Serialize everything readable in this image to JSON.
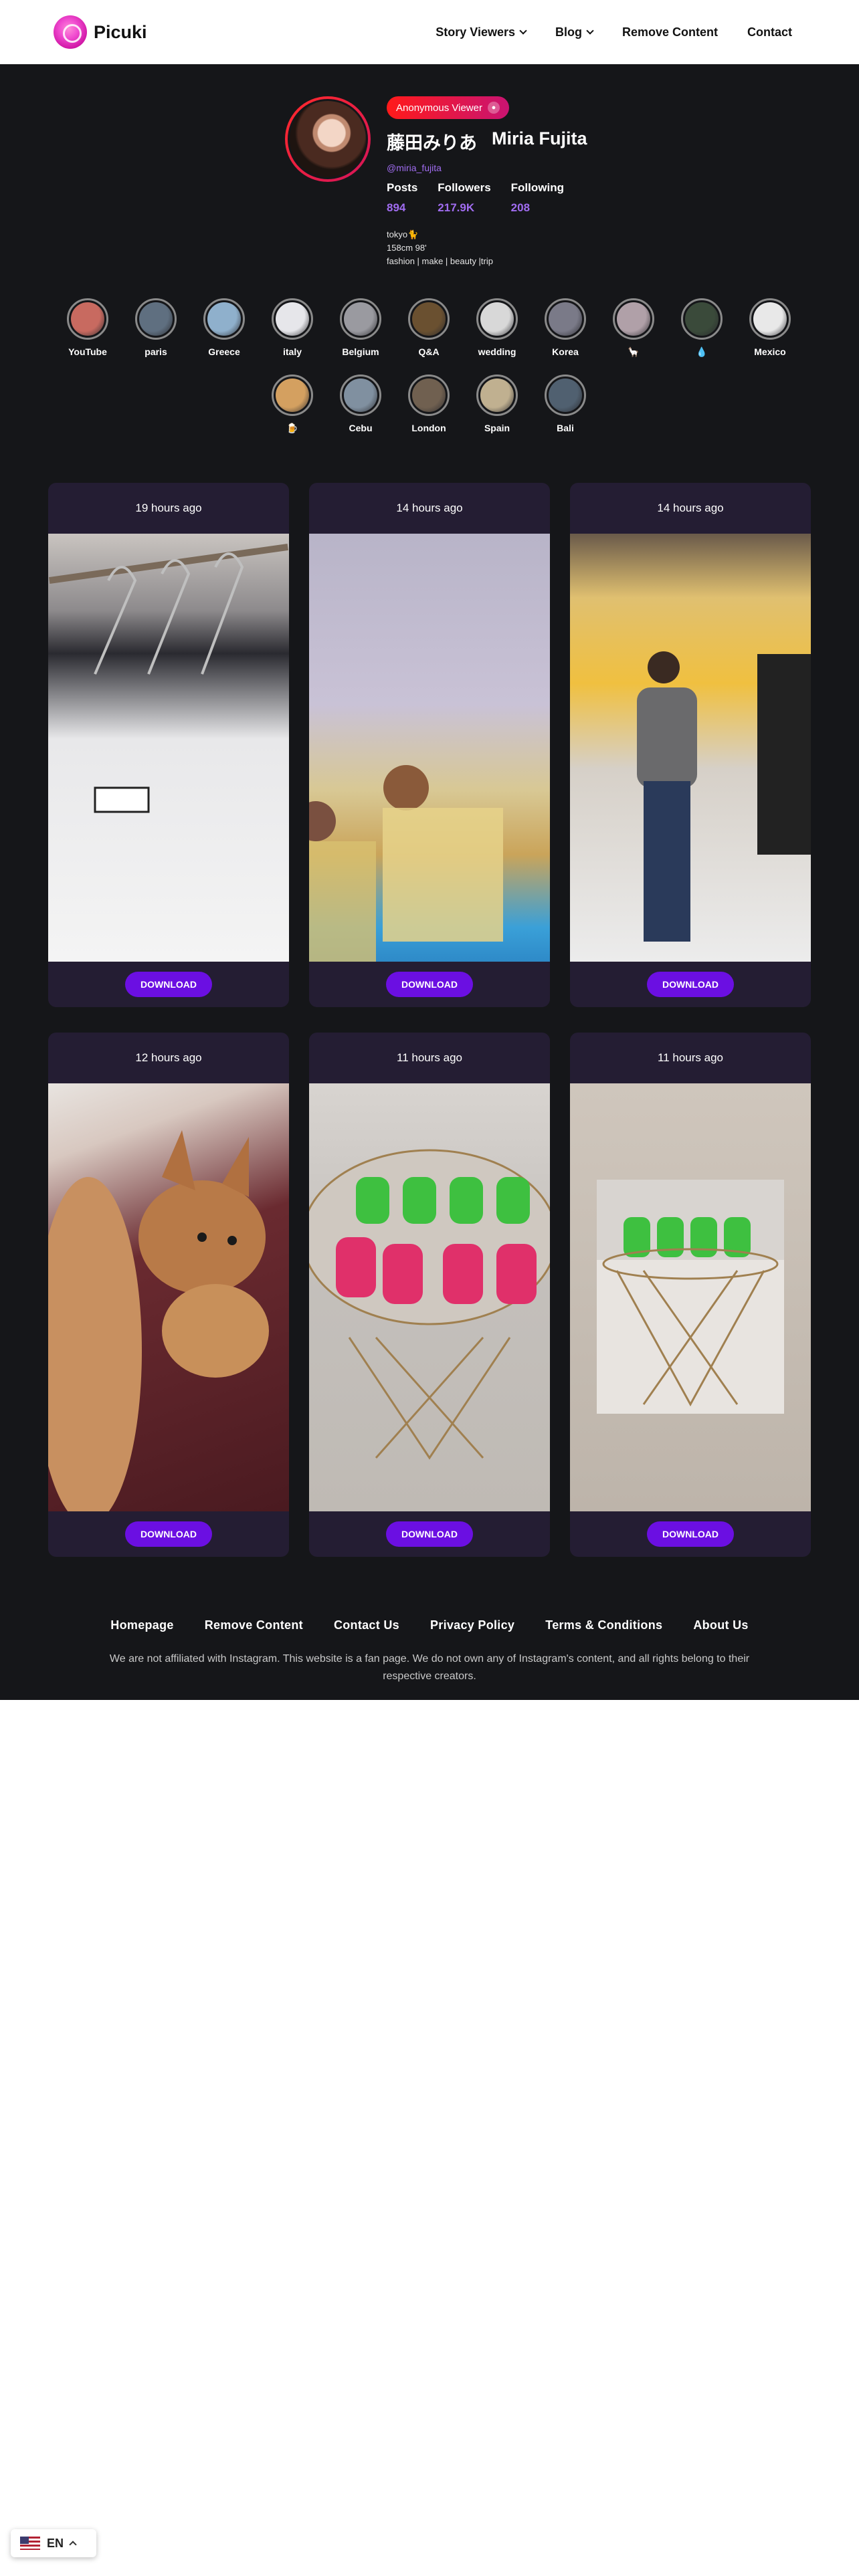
{
  "header": {
    "brand": "Picuki",
    "nav": [
      {
        "label": "Story Viewers",
        "has_dropdown": true
      },
      {
        "label": "Blog",
        "has_dropdown": true
      },
      {
        "label": "Remove Content",
        "has_dropdown": false
      },
      {
        "label": "Contact",
        "has_dropdown": false
      }
    ]
  },
  "profile": {
    "badge": "Anonymous Viewer",
    "name_jp": "藤田みりあ",
    "name_en": "Miria Fujita",
    "handle": "@miria_fujita",
    "stats": [
      {
        "label": "Posts",
        "value": "894"
      },
      {
        "label": "Followers",
        "value": "217.9K"
      },
      {
        "label": "Following",
        "value": "208"
      }
    ],
    "bio": [
      "tokyo🐈",
      "158cm 98'",
      "fashion | make | beauty |trip"
    ]
  },
  "highlights": [
    {
      "label": "YouTube",
      "color": "#c86a60"
    },
    {
      "label": "paris",
      "color": "#5f6f80"
    },
    {
      "label": "Greece",
      "color": "#8fb0cc"
    },
    {
      "label": "italy",
      "color": "#e6e6ea"
    },
    {
      "label": "Belgium",
      "color": "#9a9aa0"
    },
    {
      "label": "Q&A",
      "color": "#6a5030"
    },
    {
      "label": "wedding",
      "color": "#d8d8d8"
    },
    {
      "label": "Korea",
      "color": "#7a7a88"
    },
    {
      "label": "🦙",
      "color": "#b0a0a8"
    },
    {
      "label": "💧",
      "color": "#3a4a3a"
    },
    {
      "label": "Mexico",
      "color": "#e8e8e8"
    },
    {
      "label": "🍺",
      "color": "#d4a060"
    },
    {
      "label": "Cebu",
      "color": "#8090a0"
    },
    {
      "label": "London",
      "color": "#706050"
    },
    {
      "label": "Spain",
      "color": "#c0b090"
    },
    {
      "label": "Bali",
      "color": "#506070"
    }
  ],
  "posts": [
    {
      "time": "19 hours ago",
      "download": "DOWNLOAD",
      "image": "white-tshirt-on-hangers"
    },
    {
      "time": "14 hours ago",
      "download": "DOWNLOAD",
      "image": "perfume-bottles"
    },
    {
      "time": "14 hours ago",
      "download": "DOWNLOAD",
      "image": "mirror-selfie-store"
    },
    {
      "time": "12 hours ago",
      "download": "DOWNLOAD",
      "image": "chihuahua-dog"
    },
    {
      "time": "11 hours ago",
      "download": "DOWNLOAD",
      "image": "green-pink-crocs-table"
    },
    {
      "time": "11 hours ago",
      "download": "DOWNLOAD",
      "image": "crocs-photo-on-table"
    }
  ],
  "footer": {
    "links": [
      "Homepage",
      "Remove Content",
      "Contact Us",
      "Privacy Policy",
      "Terms & Conditions",
      "About Us"
    ],
    "note": "We are not affiliated with Instagram. This website is a fan page. We do not own any of Instagram's content, and all rights belong to their respective creators."
  },
  "language": {
    "code": "EN"
  }
}
